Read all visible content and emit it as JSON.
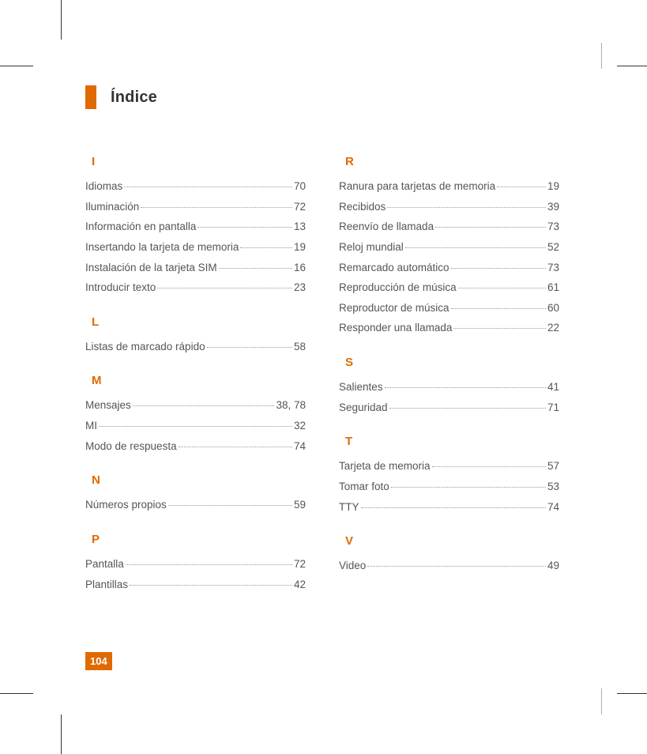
{
  "header": {
    "title": "Índice"
  },
  "page_number": "104",
  "columns": [
    [
      {
        "letter": "I",
        "entries": [
          {
            "term": "Idiomas",
            "page": "70"
          },
          {
            "term": "Iluminación",
            "page": "72"
          },
          {
            "term": "Información en pantalla",
            "page": "13"
          },
          {
            "term": "Insertando la tarjeta de memoria",
            "page": "19"
          },
          {
            "term": "Instalación de la tarjeta SIM",
            "page": "16"
          },
          {
            "term": "Introducir texto",
            "page": "23"
          }
        ]
      },
      {
        "letter": "L",
        "entries": [
          {
            "term": "Listas de marcado rápido",
            "page": "58"
          }
        ]
      },
      {
        "letter": "M",
        "entries": [
          {
            "term": "Mensajes",
            "page": "38, 78"
          },
          {
            "term": "MI",
            "page": "32"
          },
          {
            "term": "Modo de respuesta",
            "page": "74"
          }
        ]
      },
      {
        "letter": "N",
        "entries": [
          {
            "term": "Números propios",
            "page": "59"
          }
        ]
      },
      {
        "letter": "P",
        "entries": [
          {
            "term": "Pantalla",
            "page": "72"
          },
          {
            "term": "Plantillas",
            "page": "42"
          }
        ]
      }
    ],
    [
      {
        "letter": "R",
        "entries": [
          {
            "term": "Ranura para tarjetas de memoria",
            "page": "19"
          },
          {
            "term": "Recibidos",
            "page": "39"
          },
          {
            "term": "Reenvío de llamada",
            "page": "73"
          },
          {
            "term": "Reloj mundial",
            "page": "52"
          },
          {
            "term": "Remarcado automático",
            "page": "73"
          },
          {
            "term": "Reproducción de música",
            "page": "61"
          },
          {
            "term": "Reproductor de música",
            "page": "60"
          },
          {
            "term": "Responder una llamada",
            "page": "22"
          }
        ]
      },
      {
        "letter": "S",
        "entries": [
          {
            "term": "Salientes",
            "page": "41"
          },
          {
            "term": "Seguridad",
            "page": "71"
          }
        ]
      },
      {
        "letter": "T",
        "entries": [
          {
            "term": "Tarjeta de memoria",
            "page": "57"
          },
          {
            "term": "Tomar foto",
            "page": "53"
          },
          {
            "term": "TTY",
            "page": "74"
          }
        ]
      },
      {
        "letter": "V",
        "entries": [
          {
            "term": "Video",
            "page": "49"
          }
        ]
      }
    ]
  ]
}
